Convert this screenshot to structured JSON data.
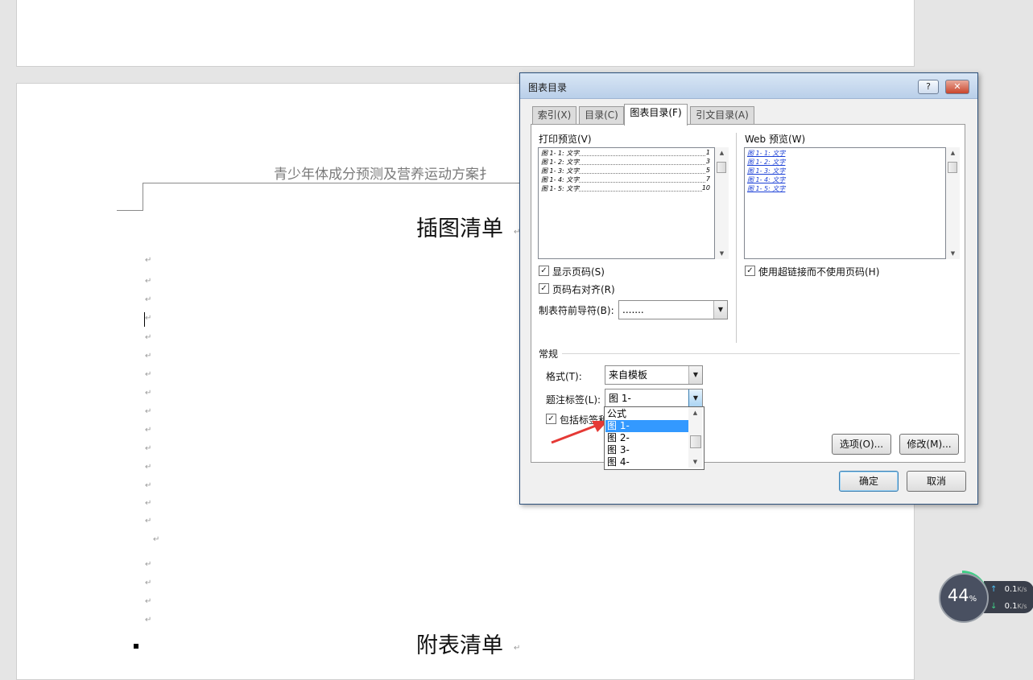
{
  "document": {
    "header_text": "青少年体成分预测及营养运动方案扌",
    "heading_figures": "插图清单",
    "heading_tables": "附表清单",
    "paragraph_mark": "↵"
  },
  "dialog": {
    "title": "图表目录",
    "help_label": "?",
    "close_label": "✕",
    "tabs": [
      "索引(X)",
      "目录(C)",
      "图表目录(F)",
      "引文目录(A)"
    ],
    "print_preview_label": "打印预览(V)",
    "web_preview_label": "Web 预览(W)",
    "print_preview_lines": [
      {
        "text": "图 1- 1: 文字",
        "page": "1"
      },
      {
        "text": "图 1- 2: 文字",
        "page": "3"
      },
      {
        "text": "图 1- 3: 文字",
        "page": "5"
      },
      {
        "text": "图 1- 4: 文字",
        "page": "7"
      },
      {
        "text": "图 1- 5: 文字",
        "page": "10"
      }
    ],
    "web_preview_lines": [
      "图 1- 1: 文字",
      "图 1- 2: 文字",
      "图 1- 3: 文字",
      "图 1- 4: 文字",
      "图 1- 5: 文字"
    ],
    "show_page_numbers": {
      "label": "显示页码(S)",
      "checked": true
    },
    "right_align": {
      "label": "页码右对齐(R)",
      "checked": true
    },
    "tab_leader": {
      "label": "制表符前导符(B):",
      "value": "......."
    },
    "use_hyperlinks": {
      "label": "使用超链接而不使用页码(H)",
      "checked": true
    },
    "general_label": "常规",
    "format": {
      "label": "格式(T):",
      "value": "来自模板"
    },
    "caption_label": {
      "label": "题注标签(L):",
      "value": "图 1-"
    },
    "include_label": {
      "label": "包括标签和",
      "checked": true
    },
    "caption_options": [
      "公式",
      "图 1-",
      "图 2-",
      "图 3-",
      "图 4-"
    ],
    "selected_option": "图 1-",
    "options_button": "选项(O)...",
    "modify_button": "修改(M)...",
    "ok_button": "确定",
    "cancel_button": "取消",
    "check_glyph": "✓"
  },
  "network_widget": {
    "percent": "44",
    "percent_unit": "%",
    "upload": "0.1",
    "download": "0.1",
    "unit": "K/s",
    "up_arrow": "↑",
    "down_arrow": "↓"
  },
  "colors": {
    "selection": "#3399ff",
    "gauge_ring": "#3fcf86",
    "arrow": "#e53935"
  }
}
